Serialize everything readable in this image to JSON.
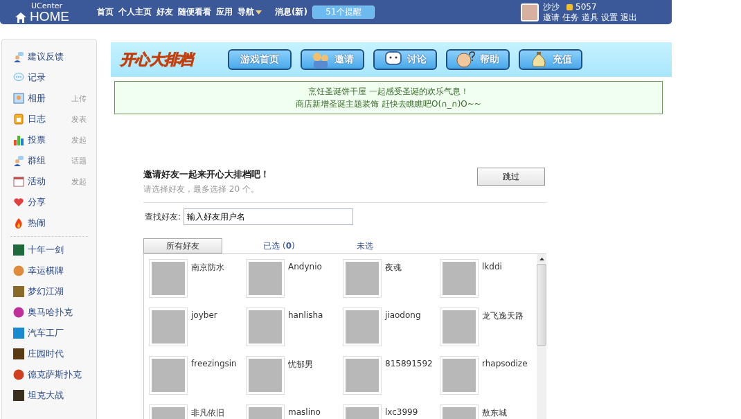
{
  "header": {
    "brand_small": "UCenter",
    "brand": "HOME",
    "nav": [
      "首页",
      "个人主页",
      "好友",
      "随便看看",
      "应用",
      "导航"
    ],
    "messages": "消息(新)",
    "reminder": "51个提醒",
    "user": {
      "name": "沙沙",
      "coins": "5057",
      "links": [
        "邀请",
        "任务",
        "道具",
        "设置",
        "退出"
      ]
    }
  },
  "sidebar": {
    "groups": [
      [
        {
          "label": "建议反馈"
        },
        {
          "label": "记录"
        },
        {
          "label": "相册",
          "action": "上传"
        },
        {
          "label": "日志",
          "action": "发表"
        },
        {
          "label": "投票",
          "action": "发起"
        },
        {
          "label": "群组",
          "action": "话题"
        },
        {
          "label": "活动",
          "action": "发起"
        },
        {
          "label": "分享"
        },
        {
          "label": "热闹"
        }
      ],
      [
        {
          "label": "十年一剑"
        },
        {
          "label": "幸运棋牌"
        },
        {
          "label": "梦幻江湖"
        },
        {
          "label": "奥马哈扑克"
        },
        {
          "label": "汽车工厂"
        },
        {
          "label": "庄园时代"
        },
        {
          "label": "德克萨斯扑克"
        },
        {
          "label": "坦克大战"
        }
      ]
    ]
  },
  "game": {
    "logo": "开心大排档",
    "buttons": [
      "游戏首页",
      "邀请",
      "讨论",
      "帮助",
      "充值"
    ]
  },
  "notice": [
    "烹饪圣诞饼干屋 一起感受圣诞的欢乐气息！",
    "商店新增圣诞主题装饰 赶快去瞧瞧吧O(∩_∩)O~~"
  ],
  "invite": {
    "title": "邀请好友一起来开心大排档吧！",
    "hint": "请选择好友，最多选择 20 个。",
    "skip": "跳过",
    "search_label": "查找好友:",
    "search_value": "输入好友用户名",
    "tabs": [
      {
        "label": "所有好友",
        "selected": true
      },
      {
        "label": "已选 (**0**)",
        "selected": false
      },
      {
        "label": "未选",
        "selected": false
      }
    ],
    "friends": [
      "南京防水",
      "Andynio",
      "夜魂",
      "lkddi",
      "joyber",
      "hanlisha",
      "jiaodong",
      "龙飞逸天路",
      "freezingsin",
      "忧郁男",
      "815891592",
      "rhapsodize",
      "非凡依旧",
      "maslino",
      "lxc3999",
      "敖东城"
    ]
  }
}
